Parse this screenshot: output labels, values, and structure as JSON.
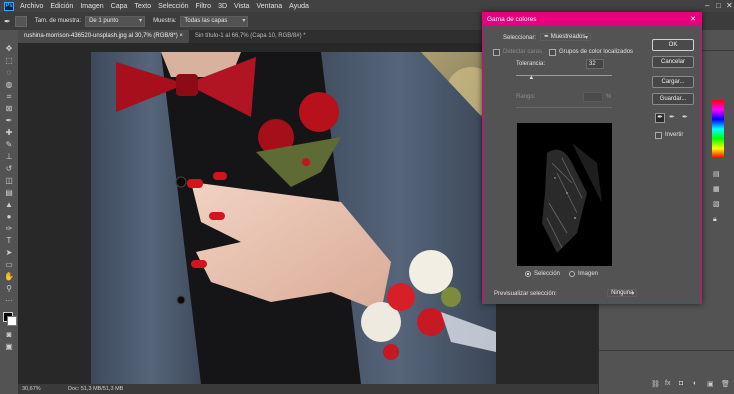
{
  "menu": {
    "items": [
      "Archivo",
      "Edición",
      "Imagen",
      "Capa",
      "Texto",
      "Selección",
      "Filtro",
      "3D",
      "Vista",
      "Ventana",
      "Ayuda"
    ],
    "logo": "Ps"
  },
  "options": {
    "sample_size_label": "Tam. de muestra:",
    "sample_size_value": "De 1 punto",
    "sample_label": "Muestra:",
    "sample_value": "Todas las capas"
  },
  "tabs": [
    {
      "label": "rushina-morrison-436520-unsplash.jpg al 30,7% (RGB/8*) ×",
      "active": true
    },
    {
      "label": "Sin título-1 al 66,7% (Capa 10, RGB/8#) *",
      "active": false
    }
  ],
  "status": {
    "zoom": "30,67%",
    "doc": "Doc: 51,3 MB/51,3 MB"
  },
  "dialog": {
    "title": "Gama de colores",
    "select_label": "Seleccionar:",
    "select_value": "Muestreados",
    "detect_faces": "Detectar caras",
    "localized_groups": "Grupos de color localizados",
    "tolerance_label": "Tolerancia:",
    "tolerance_value": "32",
    "tolerance_fraction": 0.16,
    "range_label": "Rango:",
    "range_unit": "%",
    "radio_selection": "Selección",
    "radio_image": "Imagen",
    "preview_label": "Previsualizar selección:",
    "preview_value": "Ninguna",
    "buttons": {
      "ok": "OK",
      "cancel": "Cancelar",
      "load": "Cargar...",
      "save": "Guardar..."
    },
    "invert_label": "Invertir",
    "accent": "#e6007e"
  },
  "colors": {
    "menubar": "#424242",
    "panel": "#535353",
    "canvas_bg": "#282828",
    "dialog_accent": "#e6007e"
  }
}
